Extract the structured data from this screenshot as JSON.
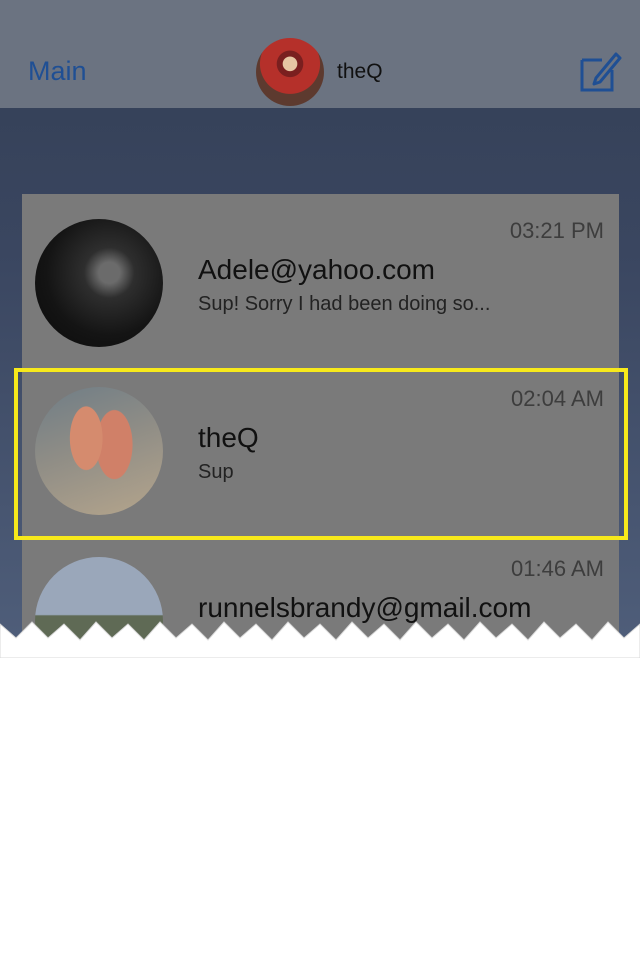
{
  "nav": {
    "back_label": "Main",
    "title": "theQ",
    "avatar_icon": "profile-avatar",
    "compose_icon": "compose-icon"
  },
  "conversations": [
    {
      "name": "Adele@yahoo.com",
      "preview": "Sup! Sorry I had been doing so...",
      "time": "03:21 PM"
    },
    {
      "name": "theQ",
      "preview": "Sup",
      "time": "02:04 AM"
    },
    {
      "name": "runnelsbrandy@gmail.com",
      "preview": "",
      "time": "01:46 AM"
    }
  ],
  "colors": {
    "highlight": "#f7e91b",
    "nav_link": "#1f4f94"
  }
}
